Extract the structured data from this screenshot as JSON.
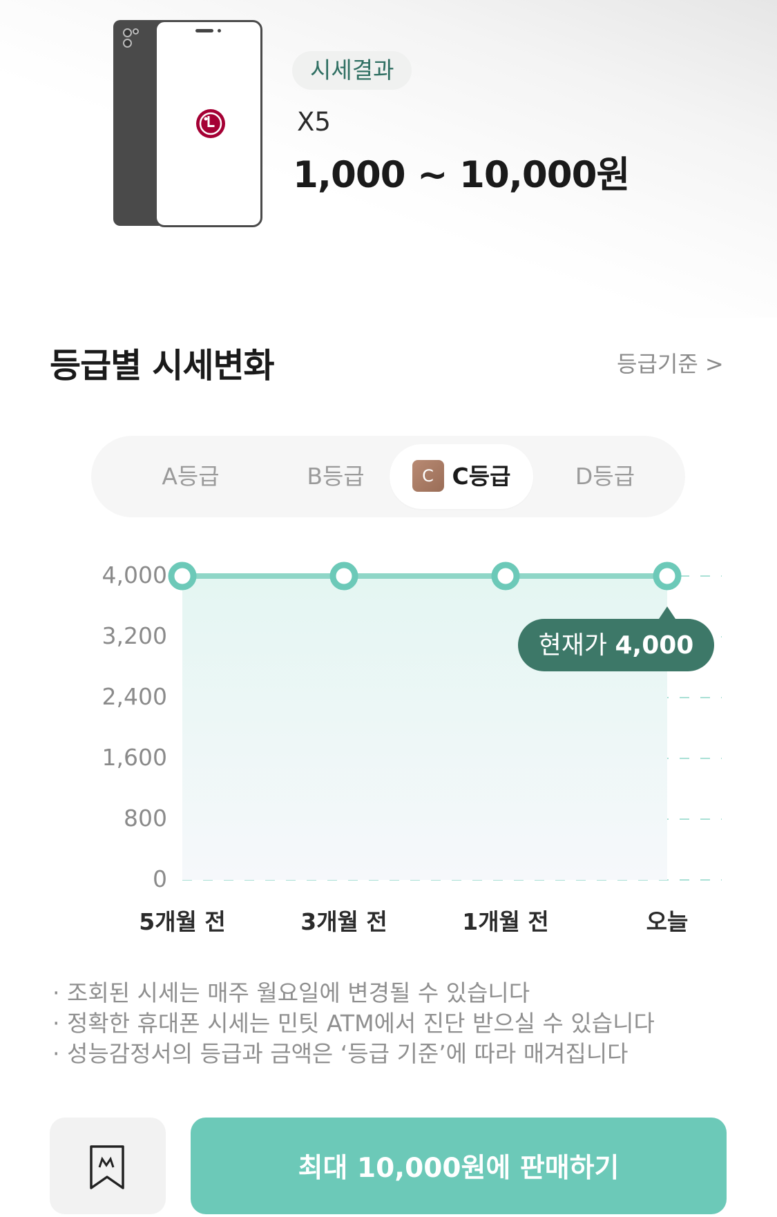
{
  "product": {
    "badge": "시세결과",
    "model": "X5",
    "price_range": "1,000 ~ 10,000원",
    "logo_icon": "lg-logo-icon",
    "logo_text": "LG"
  },
  "section": {
    "title": "등급별 시세변화",
    "criteria_link": "등급기준 >"
  },
  "grade_tabs": [
    {
      "label": "A등급",
      "active": false
    },
    {
      "label": "B등급",
      "active": false
    },
    {
      "label": "C등급",
      "active": true,
      "chip": "C"
    },
    {
      "label": "D등급",
      "active": false
    }
  ],
  "chart_data": {
    "type": "area",
    "categories": [
      "5개월 전",
      "3개월 전",
      "1개월 전",
      "오늘"
    ],
    "values": [
      4000,
      4000,
      4000,
      4000
    ],
    "y_ticks": [
      "4,000",
      "3,200",
      "2,400",
      "1,600",
      "800",
      "0"
    ],
    "ylim": [
      0,
      4000
    ],
    "grid": true,
    "line_color": "#8fd6c7",
    "marker_color": "#6cc9b8",
    "tooltip": {
      "label": "현재가",
      "value": "4,000"
    }
  },
  "notes": [
    "조회된 시세는 매주 월요일에 변경될 수 있습니다",
    "정확한 휴대폰 시세는 민팃 ATM에서 진단 받으실 수 있습니다",
    "성능감정서의 등급과 금액은 ‘등급 기준’에 따라 매겨집니다"
  ],
  "bottom": {
    "bookmark_icon": "bookmark-icon",
    "sell_prefix": "최대 ",
    "sell_amount": "10,000원",
    "sell_suffix": "에 판매하기"
  },
  "colors": {
    "accent": "#6cc9b8",
    "badge_text": "#2f6f62",
    "tooltip_bg": "#3d7868"
  }
}
